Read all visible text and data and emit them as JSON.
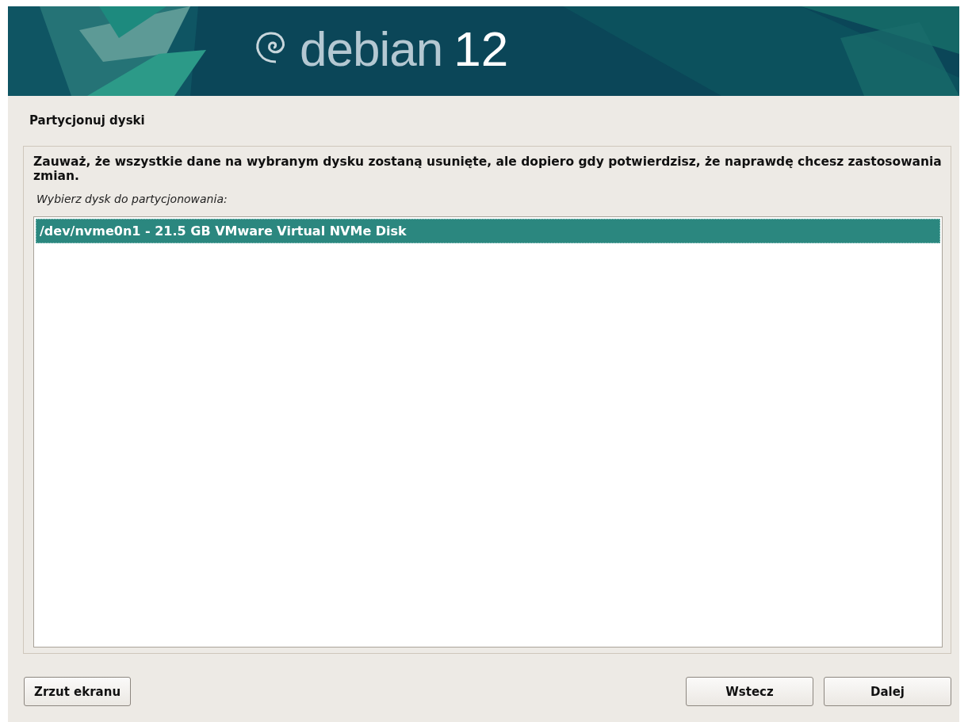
{
  "banner": {
    "brand": "debian",
    "version": "12"
  },
  "title": "Partycjonuj dyski",
  "warning": "Zauważ, że wszystkie dane na wybranym dysku zostaną usunięte, ale dopiero gdy potwierdzisz, że naprawdę chcesz zastosowania zmian.",
  "prompt": "Wybierz dysk do partycjonowania:",
  "disks": [
    {
      "label": "/dev/nvme0n1 - 21.5 GB VMware Virtual NVMe Disk",
      "selected": true
    }
  ],
  "buttons": {
    "left": [
      {
        "label": "Zrzut ekranu"
      }
    ],
    "right": [
      {
        "label": "Wstecz"
      },
      {
        "label": "Dalej"
      }
    ]
  }
}
